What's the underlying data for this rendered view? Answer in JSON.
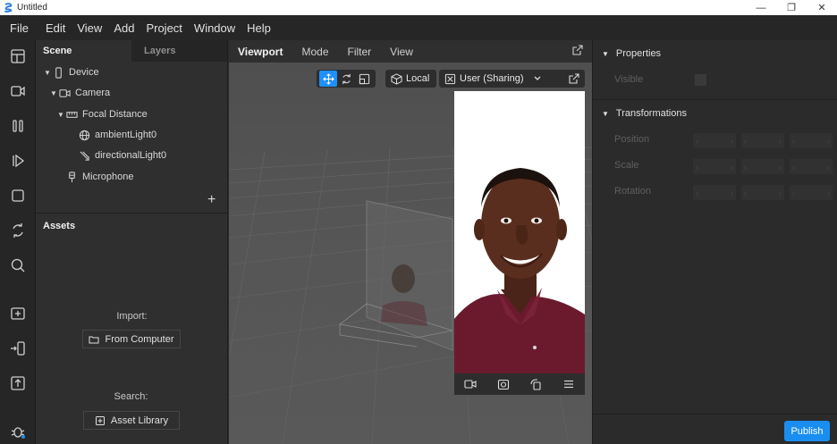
{
  "window": {
    "title": "Untitled",
    "controls": {
      "minimize": "—",
      "restore": "❐",
      "close": "✕"
    }
  },
  "menu": [
    "File",
    "Edit",
    "View",
    "Add",
    "Project",
    "Window",
    "Help"
  ],
  "toolbar": {
    "icons": [
      "layout-icon",
      "video-icon",
      "pause-icon",
      "play-step-icon",
      "square-icon",
      "sync-icon",
      "search-icon",
      "add-folder-icon",
      "import-icon",
      "upload-icon",
      "bug-icon"
    ]
  },
  "scene": {
    "tabs": {
      "scene": "Scene",
      "layers": "Layers"
    },
    "items": [
      {
        "label": "Device"
      },
      {
        "label": "Camera"
      },
      {
        "label": "Focal Distance"
      },
      {
        "label": "ambientLight0"
      },
      {
        "label": "directionalLight0"
      },
      {
        "label": "Microphone"
      }
    ],
    "add": "+"
  },
  "assets": {
    "title": "Assets",
    "import_label": "Import:",
    "from_computer": "From Computer",
    "search_label": "Search:",
    "asset_library": "Asset Library"
  },
  "viewport": {
    "tabs": {
      "viewport": "Viewport",
      "mode": "Mode",
      "filter": "Filter",
      "view": "View"
    },
    "local_label": "Local",
    "camera_select": "User (Sharing)"
  },
  "properties": {
    "title": "Properties",
    "visible_label": "Visible",
    "transformations_title": "Transformations",
    "position_label": "Position",
    "scale_label": "Scale",
    "rotation_label": "Rotation",
    "publish_label": "Publish"
  },
  "colors": {
    "accent": "#1a8ef0",
    "panel": "#2f2f2f",
    "background": "#2b2b2b"
  }
}
